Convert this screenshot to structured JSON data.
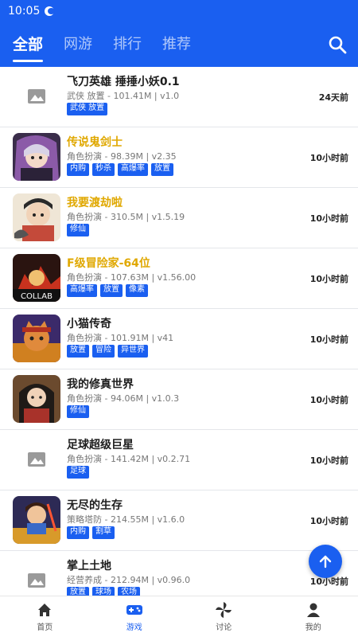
{
  "status": {
    "time": "10:05"
  },
  "header": {
    "tabs": [
      {
        "label": "全部",
        "active": true
      },
      {
        "label": "网游",
        "active": false
      },
      {
        "label": "排行",
        "active": false
      },
      {
        "label": "推荐",
        "active": false
      }
    ],
    "search_icon": "search-icon"
  },
  "games": [
    {
      "title": "飞刀英雄 捶捶小妖0.1",
      "meta": "武侠 放置 - 101.41M | v1.0",
      "tags": [
        "武侠 放置"
      ],
      "time": "24天前",
      "highlight": false,
      "thumb": "placeholder"
    },
    {
      "title": "传说鬼剑士",
      "meta": "角色扮演 - 98.39M | v2.35",
      "tags": [
        "内购",
        "秒杀",
        "高爆率",
        "放置"
      ],
      "time": "10小时前",
      "highlight": true,
      "thumb": "art"
    },
    {
      "title": "我要渡劫啦",
      "meta": "角色扮演 - 310.5M | v1.5.19",
      "tags": [
        "修仙"
      ],
      "time": "10小时前",
      "highlight": true,
      "thumb": "art"
    },
    {
      "title": "F级冒险家-64位",
      "meta": "角色扮演 - 107.63M | v1.56.00",
      "tags": [
        "高爆率",
        "放置",
        "像素"
      ],
      "time": "10小时前",
      "highlight": true,
      "thumb": "art"
    },
    {
      "title": "小猫传奇",
      "meta": "角色扮演 - 101.91M | v41",
      "tags": [
        "放置",
        "冒险",
        "异世界"
      ],
      "time": "10小时前",
      "highlight": false,
      "thumb": "art"
    },
    {
      "title": "我的修真世界",
      "meta": "角色扮演 - 94.06M | v1.0.3",
      "tags": [
        "修仙"
      ],
      "time": "10小时前",
      "highlight": false,
      "thumb": "art"
    },
    {
      "title": "足球超级巨星",
      "meta": "角色扮演 - 141.42M | v0.2.71",
      "tags": [
        "足球"
      ],
      "time": "10小时前",
      "highlight": false,
      "thumb": "placeholder"
    },
    {
      "title": "无尽的生存",
      "meta": "策略塔防 - 214.55M | v1.6.0",
      "tags": [
        "内购",
        "割草"
      ],
      "time": "10小时前",
      "highlight": false,
      "thumb": "art"
    },
    {
      "title": "掌上土地",
      "meta": "经营养成 - 212.94M | v0.96.0",
      "tags": [
        "放置",
        "球场",
        "农场"
      ],
      "time": "10小时前",
      "highlight": false,
      "thumb": "placeholder"
    }
  ],
  "thumb_text": {
    "f_level": "COLLAB"
  },
  "fab": {
    "icon": "arrow-up-icon"
  },
  "bottom_nav": [
    {
      "label": "首页",
      "icon": "home-icon",
      "active": false
    },
    {
      "label": "游戏",
      "icon": "gamepad-icon",
      "active": true
    },
    {
      "label": "讨论",
      "icon": "pinwheel-icon",
      "active": false
    },
    {
      "label": "我的",
      "icon": "person-icon",
      "active": false
    }
  ],
  "colors": {
    "primary": "#1a5ff0",
    "highlight_title": "#e0a800"
  }
}
